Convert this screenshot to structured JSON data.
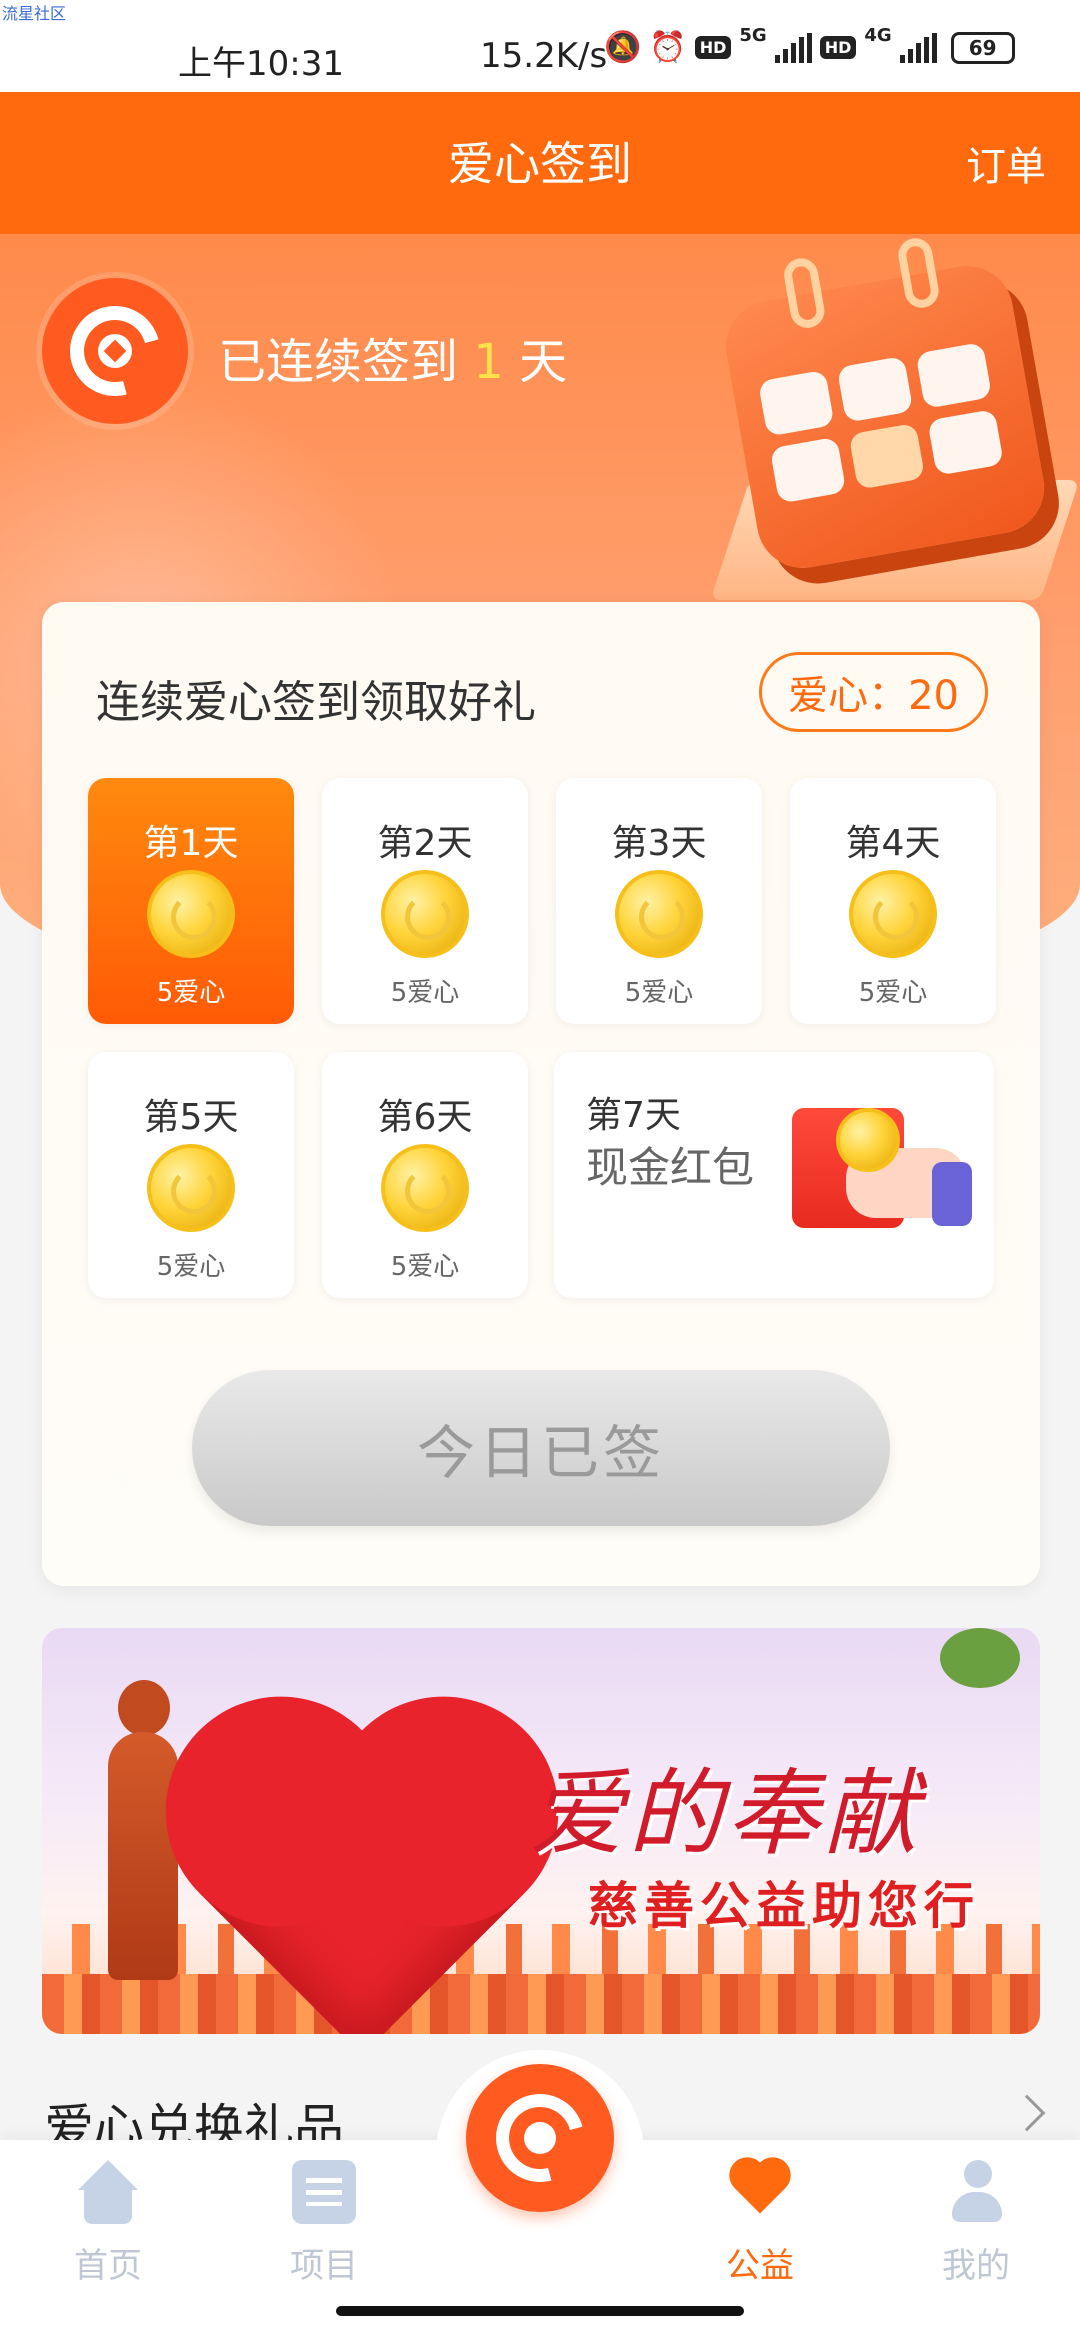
{
  "status_bar": {
    "watermark": "流星社区",
    "time": "上午10:31",
    "net_speed": "15.2K/s",
    "hd1": "HD",
    "net1": "5G",
    "hd2": "HD",
    "net2": "4G",
    "battery": "69"
  },
  "header": {
    "title": "爱心签到",
    "order": "订单"
  },
  "hero": {
    "streak_prefix": "已连续签到 ",
    "streak_days": "1",
    "streak_suffix": " 天"
  },
  "signin": {
    "title": "连续爱心签到领取好礼",
    "points": "爱心：20",
    "days": [
      {
        "label": "第1天",
        "reward": "5爱心",
        "active": true
      },
      {
        "label": "第2天",
        "reward": "5爱心",
        "active": false
      },
      {
        "label": "第3天",
        "reward": "5爱心",
        "active": false
      },
      {
        "label": "第4天",
        "reward": "5爱心",
        "active": false
      },
      {
        "label": "第5天",
        "reward": "5爱心",
        "active": false
      },
      {
        "label": "第6天",
        "reward": "5爱心",
        "active": false
      }
    ],
    "day7": {
      "label": "第7天",
      "reward": "现金红包"
    },
    "button": "今日已签"
  },
  "banner": {
    "title": "爱的奉献",
    "subtitle": "慈善公益助您行"
  },
  "section": {
    "title": "爱心兑换礼品"
  },
  "tabs": [
    {
      "label": "首页",
      "icon": "home-icon",
      "active": false
    },
    {
      "label": "项目",
      "icon": "list-icon",
      "active": false
    },
    {
      "label": "公益",
      "icon": "heart-hands-icon",
      "active": true
    },
    {
      "label": "我的",
      "icon": "user-icon",
      "active": false
    }
  ],
  "colors": {
    "accent": "#ff6a0e",
    "active_day": "#ff6a0e",
    "tab_inactive": "#bfc6d4"
  }
}
